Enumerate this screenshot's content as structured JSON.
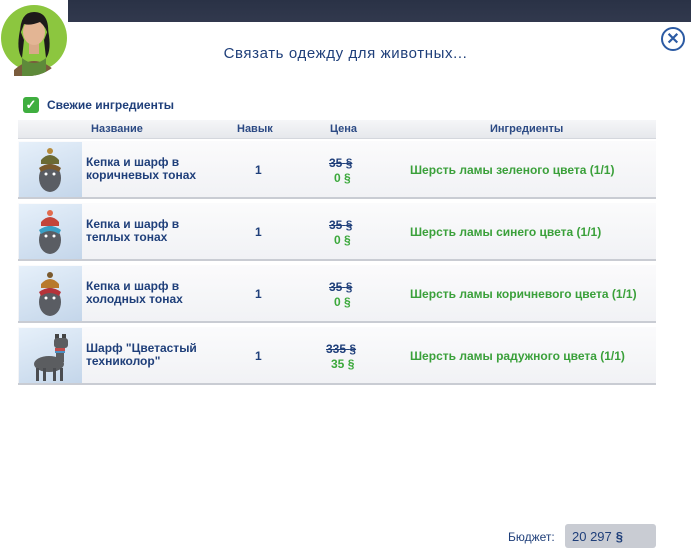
{
  "dialog": {
    "title": "Связать одежду для животных...",
    "close_icon": "close-icon"
  },
  "filter": {
    "label": "Свежие ингредиенты",
    "checked": true
  },
  "columns": {
    "name": "Название",
    "skill": "Навык",
    "price": "Цена",
    "ingredients": "Ингредиенты"
  },
  "currency": "§",
  "items": [
    {
      "name": "Кепка и шарф в коричневых тонах",
      "skill": "1",
      "old_price": "35",
      "new_price": "0",
      "ingredient": "Шерсть ламы зеленого цвета (1/1)",
      "thumb_icon": "pet-cap-scarf-brown-icon"
    },
    {
      "name": "Кепка и шарф в теплых тонах",
      "skill": "1",
      "old_price": "35",
      "new_price": "0",
      "ingredient": "Шерсть ламы синего цвета (1/1)",
      "thumb_icon": "pet-cap-scarf-warm-icon"
    },
    {
      "name": "Кепка и шарф в холодных тонах",
      "skill": "1",
      "old_price": "35",
      "new_price": "0",
      "ingredient": "Шерсть ламы коричневого цвета (1/1)",
      "thumb_icon": "pet-cap-scarf-cold-icon"
    },
    {
      "name": "Шарф \"Цветастый техниколор\"",
      "skill": "1",
      "old_price": "335",
      "new_price": "35",
      "ingredient": "Шерсть ламы радужного цвета (1/1)",
      "thumb_icon": "llama-scarf-icon"
    }
  ],
  "budget": {
    "label": "Бюджет:",
    "value": "20 297"
  },
  "colors": {
    "title": "#1f3f7a",
    "green": "#3ba83b",
    "accent": "#2b5aa3"
  }
}
